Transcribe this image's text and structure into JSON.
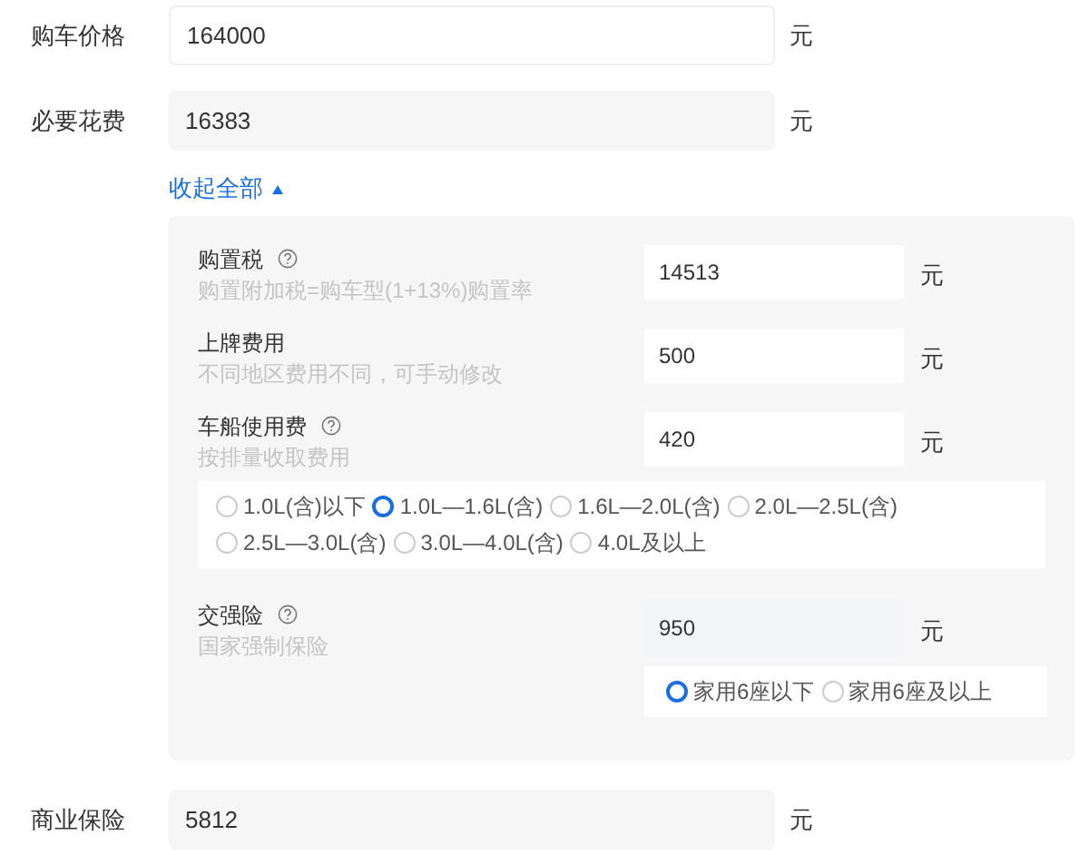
{
  "fields": [
    {
      "label": "购车价格",
      "value": "164000",
      "unit": "元",
      "readonly": false
    },
    {
      "label": "必要花费",
      "value": "16383",
      "unit": "元",
      "readonly": true
    }
  ],
  "toggle": {
    "label": "收起全部",
    "expanded": true
  },
  "details": [
    {
      "label": "购置税",
      "help": true,
      "hint": "购置附加税=购车型(1+13%)购置率",
      "value": "14513",
      "unit": "元",
      "readonly": false
    },
    {
      "label": "上牌费用",
      "help": false,
      "hint": "不同地区费用不同，可手动修改",
      "value": "500",
      "unit": "元",
      "readonly": false
    },
    {
      "label": "车船使用费",
      "help": true,
      "hint": "按排量收取费用",
      "value": "420",
      "unit": "元",
      "readonly": false,
      "options": {
        "kind": "wide",
        "items": [
          {
            "label": "1.0L(含)以下",
            "selected": false
          },
          {
            "label": "1.0L—1.6L(含)",
            "selected": true
          },
          {
            "label": "1.6L—2.0L(含)",
            "selected": false
          },
          {
            "label": "2.0L—2.5L(含)",
            "selected": false
          },
          {
            "label": "2.5L—3.0L(含)",
            "selected": false
          },
          {
            "label": "3.0L—4.0L(含)",
            "selected": false
          },
          {
            "label": "4.0L及以上",
            "selected": false
          }
        ]
      }
    },
    {
      "label": "交强险",
      "help": true,
      "hint": "国家强制保险",
      "value": "950",
      "unit": "元",
      "readonly": true,
      "options": {
        "kind": "narrow",
        "items": [
          {
            "label": "家用6座以下",
            "selected": true
          },
          {
            "label": "家用6座及以上",
            "selected": false
          }
        ]
      }
    }
  ],
  "insurance": {
    "label": "商业保险",
    "value": "5812",
    "unit": "元",
    "readonly": true
  }
}
